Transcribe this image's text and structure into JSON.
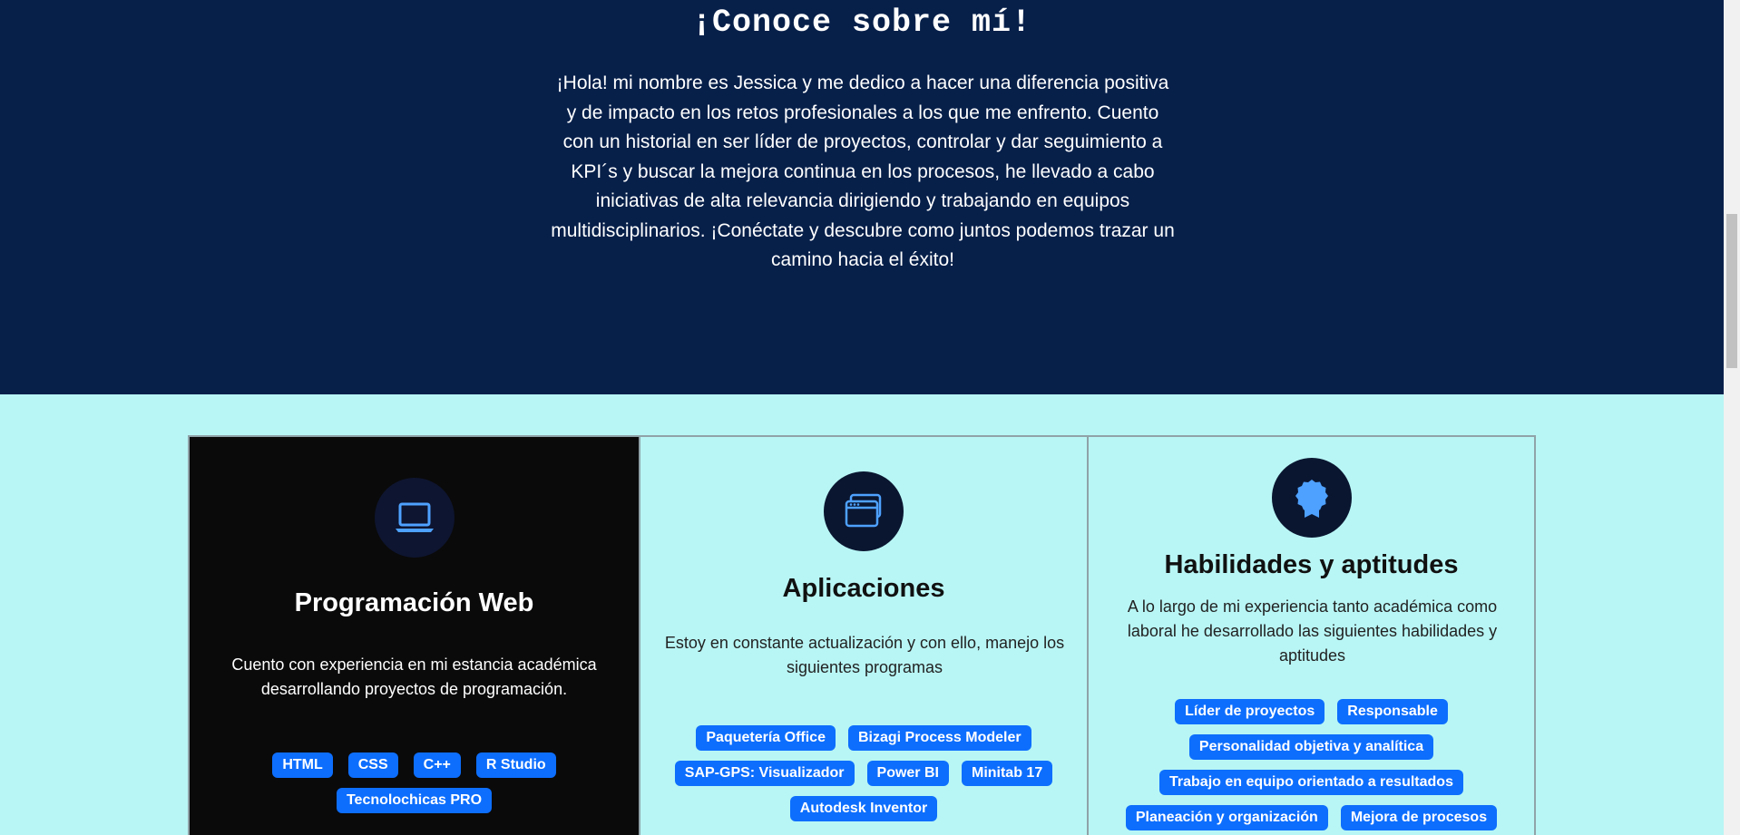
{
  "about": {
    "title": "¡Conoce sobre mí!",
    "text": "¡Hola! mi nombre es Jessica y me dedico a hacer una diferencia positiva y de impacto en los retos profesionales a los que me enfrento. Cuento con un historial en ser líder de proyectos, controlar y dar seguimiento a KPI´s y buscar la mejora continua en los procesos, he llevado a cabo iniciativas de alta relevancia dirigiendo y trabajando en equipos multidisciplinarios. ¡Conéctate y descubre como juntos podemos trazar un camino hacia el éxito!"
  },
  "colors": {
    "hero_background": "#07204a",
    "section_background": "#b8f6f5",
    "tag_background": "#0d6efd",
    "icon_accent": "#4ea1ff"
  },
  "cards": [
    {
      "icon": "laptop-icon",
      "title": "Programación Web",
      "description": "Cuento con experiencia en mi estancia académica desarrollando proyectos de programación.",
      "tags": [
        "HTML",
        "CSS",
        "C++",
        "R Studio",
        "Tecnolochicas PRO"
      ]
    },
    {
      "icon": "app-windows-icon",
      "title": "Aplicaciones",
      "description": "Estoy en constante actualización y con ello, manejo los siguientes programas",
      "tags": [
        "Paquetería Office",
        "Bizagi Process Modeler",
        "SAP-GPS: Visualizador",
        "Power BI",
        "Minitab 17",
        "Autodesk Inventor"
      ]
    },
    {
      "icon": "award-ribbon-icon",
      "title": "Habilidades y aptitudes",
      "description": "A lo largo de mi experiencia tanto académica como laboral he desarrollado las siguientes habilidades y aptitudes",
      "tags": [
        "Líder de proyectos",
        "Responsable",
        "Personalidad objetiva y analítica",
        "Trabajo en equipo orientado a resultados",
        "Planeación y organización",
        "Mejora de procesos"
      ]
    }
  ]
}
